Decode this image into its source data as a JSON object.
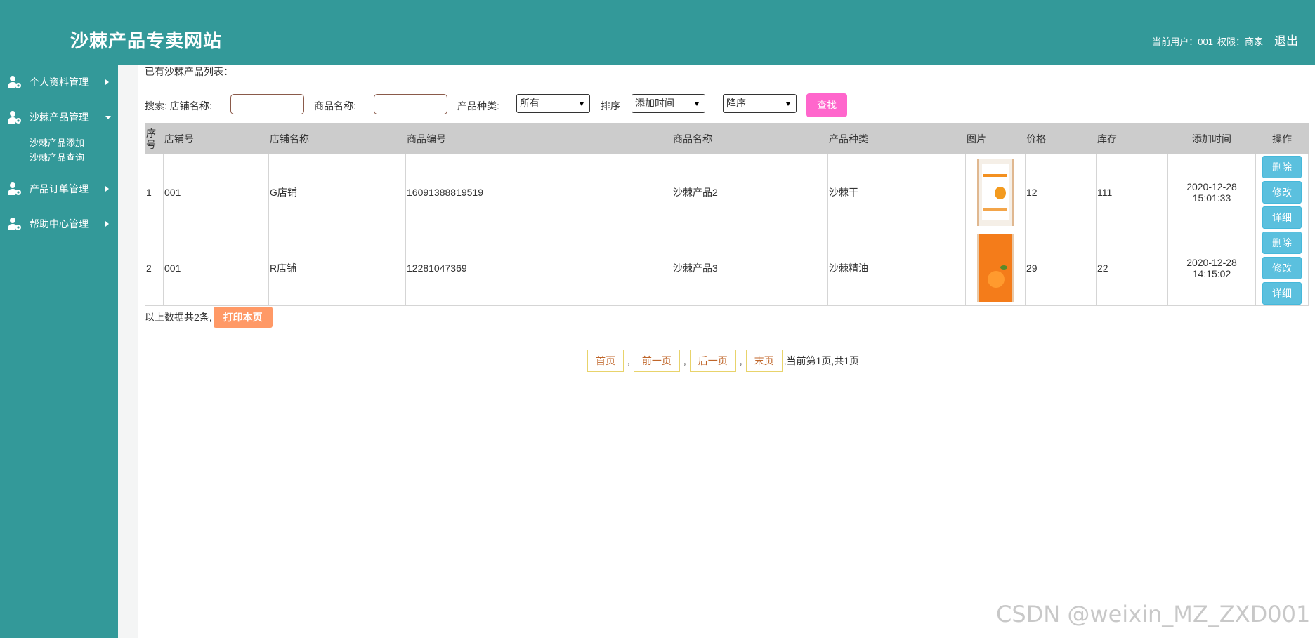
{
  "header": {
    "title": "沙棘产品专卖网站",
    "current_user_label": "当前用户：001",
    "role_label": "权限：商家",
    "logout": "退出"
  },
  "sidebar": {
    "items": [
      {
        "label": "个人资料管理",
        "icon": "user-gear-icon",
        "expanded": false
      },
      {
        "label": "沙棘产品管理",
        "icon": "user-gear-icon",
        "expanded": true,
        "subitems": [
          "沙棘产品添加",
          "沙棘产品查询"
        ]
      },
      {
        "label": "产品订单管理",
        "icon": "user-gear-icon",
        "expanded": false
      },
      {
        "label": "帮助中心管理",
        "icon": "user-gear-icon",
        "expanded": false
      }
    ]
  },
  "main": {
    "list_title": "已有沙棘产品列表：",
    "search": {
      "label_prefix": "搜索: 店铺名称:",
      "shop_name_value": "",
      "product_name_label": "商品名称:",
      "product_name_value": "",
      "category_label": "产品种类:",
      "category_selected": "所有",
      "sort_label": "排序",
      "sort_field_selected": "添加时间",
      "sort_order_selected": "降序",
      "find_button": "查找"
    },
    "table": {
      "headers": [
        "序号",
        "店铺号",
        "店铺名称",
        "商品编号",
        "商品名称",
        "产品种类",
        "图片",
        "价格",
        "库存",
        "添加时间",
        "操作"
      ],
      "rows": [
        {
          "no": "1",
          "shop_no": "001",
          "shop_name": "G店铺",
          "product_code": "16091388819519",
          "product_name": "沙棘产品2",
          "category": "沙棘干",
          "price": "12",
          "stock": "111",
          "date": "2020-12-28",
          "time": "15:01:33"
        },
        {
          "no": "2",
          "shop_no": "001",
          "shop_name": "R店铺",
          "product_code": "12281047369",
          "product_name": "沙棘产品3",
          "category": "沙棘精油",
          "price": "29",
          "stock": "22",
          "date": "2020-12-28",
          "time": "14:15:02"
        }
      ],
      "actions": {
        "delete": "删除",
        "edit": "修改",
        "detail": "详细"
      }
    },
    "summary": "以上数据共2条,",
    "print_button": "打印本页",
    "pager": {
      "first": "首页",
      "prev": "前一页",
      "next": "后一页",
      "last": "末页",
      "separator": ",",
      "info": ",当前第1页,共1页"
    }
  },
  "watermark": "CSDN @weixin_MZ_ZXD001",
  "colors": {
    "primary": "#339999",
    "find_button": "#ff66cc",
    "print_button": "#ff9966",
    "action_button": "#5bc0de",
    "table_header": "#cccccc"
  }
}
